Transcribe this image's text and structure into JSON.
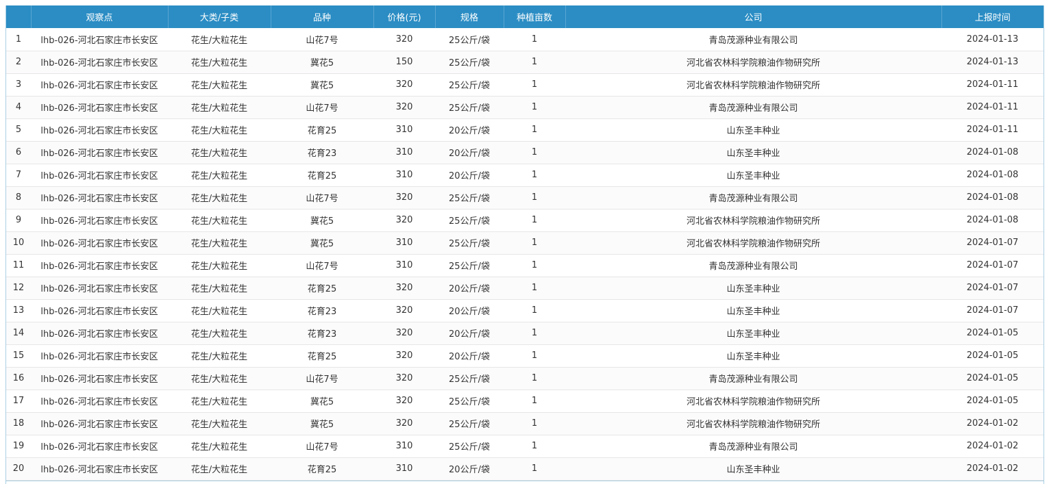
{
  "table": {
    "columns": [
      "",
      "观察点",
      "大类/子类",
      "品种",
      "价格(元)",
      "规格",
      "种植亩数",
      "公司",
      "上报时间"
    ],
    "rows": [
      [
        "1",
        "lhb-026-河北石家庄市长安区",
        "花生/大粒花生",
        "山花7号",
        "320",
        "25公斤/袋",
        "1",
        "青岛茂源种业有限公司",
        "2024-01-13"
      ],
      [
        "2",
        "lhb-026-河北石家庄市长安区",
        "花生/大粒花生",
        "冀花5",
        "150",
        "25公斤/袋",
        "1",
        "河北省农林科学院粮油作物研究所",
        "2024-01-13"
      ],
      [
        "3",
        "lhb-026-河北石家庄市长安区",
        "花生/大粒花生",
        "冀花5",
        "320",
        "25公斤/袋",
        "1",
        "河北省农林科学院粮油作物研究所",
        "2024-01-11"
      ],
      [
        "4",
        "lhb-026-河北石家庄市长安区",
        "花生/大粒花生",
        "山花7号",
        "320",
        "25公斤/袋",
        "1",
        "青岛茂源种业有限公司",
        "2024-01-11"
      ],
      [
        "5",
        "lhb-026-河北石家庄市长安区",
        "花生/大粒花生",
        "花育25",
        "310",
        "20公斤/袋",
        "1",
        "山东圣丰种业",
        "2024-01-11"
      ],
      [
        "6",
        "lhb-026-河北石家庄市长安区",
        "花生/大粒花生",
        "花育23",
        "310",
        "20公斤/袋",
        "1",
        "山东圣丰种业",
        "2024-01-08"
      ],
      [
        "7",
        "lhb-026-河北石家庄市长安区",
        "花生/大粒花生",
        "花育25",
        "310",
        "20公斤/袋",
        "1",
        "山东圣丰种业",
        "2024-01-08"
      ],
      [
        "8",
        "lhb-026-河北石家庄市长安区",
        "花生/大粒花生",
        "山花7号",
        "320",
        "25公斤/袋",
        "1",
        "青岛茂源种业有限公司",
        "2024-01-08"
      ],
      [
        "9",
        "lhb-026-河北石家庄市长安区",
        "花生/大粒花生",
        "冀花5",
        "320",
        "25公斤/袋",
        "1",
        "河北省农林科学院粮油作物研究所",
        "2024-01-08"
      ],
      [
        "10",
        "lhb-026-河北石家庄市长安区",
        "花生/大粒花生",
        "冀花5",
        "310",
        "25公斤/袋",
        "1",
        "河北省农林科学院粮油作物研究所",
        "2024-01-07"
      ],
      [
        "11",
        "lhb-026-河北石家庄市长安区",
        "花生/大粒花生",
        "山花7号",
        "310",
        "25公斤/袋",
        "1",
        "青岛茂源种业有限公司",
        "2024-01-07"
      ],
      [
        "12",
        "lhb-026-河北石家庄市长安区",
        "花生/大粒花生",
        "花育25",
        "320",
        "20公斤/袋",
        "1",
        "山东圣丰种业",
        "2024-01-07"
      ],
      [
        "13",
        "lhb-026-河北石家庄市长安区",
        "花生/大粒花生",
        "花育23",
        "320",
        "20公斤/袋",
        "1",
        "山东圣丰种业",
        "2024-01-07"
      ],
      [
        "14",
        "lhb-026-河北石家庄市长安区",
        "花生/大粒花生",
        "花育23",
        "320",
        "20公斤/袋",
        "1",
        "山东圣丰种业",
        "2024-01-05"
      ],
      [
        "15",
        "lhb-026-河北石家庄市长安区",
        "花生/大粒花生",
        "花育25",
        "320",
        "20公斤/袋",
        "1",
        "山东圣丰种业",
        "2024-01-05"
      ],
      [
        "16",
        "lhb-026-河北石家庄市长安区",
        "花生/大粒花生",
        "山花7号",
        "320",
        "25公斤/袋",
        "1",
        "青岛茂源种业有限公司",
        "2024-01-05"
      ],
      [
        "17",
        "lhb-026-河北石家庄市长安区",
        "花生/大粒花生",
        "冀花5",
        "320",
        "25公斤/袋",
        "1",
        "河北省农林科学院粮油作物研究所",
        "2024-01-05"
      ],
      [
        "18",
        "lhb-026-河北石家庄市长安区",
        "花生/大粒花生",
        "冀花5",
        "320",
        "25公斤/袋",
        "1",
        "河北省农林科学院粮油作物研究所",
        "2024-01-02"
      ],
      [
        "19",
        "lhb-026-河北石家庄市长安区",
        "花生/大粒花生",
        "山花7号",
        "310",
        "25公斤/袋",
        "1",
        "青岛茂源种业有限公司",
        "2024-01-02"
      ],
      [
        "20",
        "lhb-026-河北石家庄市长安区",
        "花生/大粒花生",
        "花育25",
        "310",
        "20公斤/袋",
        "1",
        "山东圣丰种业",
        "2024-01-02"
      ]
    ]
  },
  "colors": {
    "header_bg": "#2b8dc4",
    "header_text": "#ffffff",
    "row_text": "#333333",
    "row_alt_bg": "#fcfbfc",
    "row_border": "#e6e6e6",
    "frame_border": "#a9cfe3"
  }
}
